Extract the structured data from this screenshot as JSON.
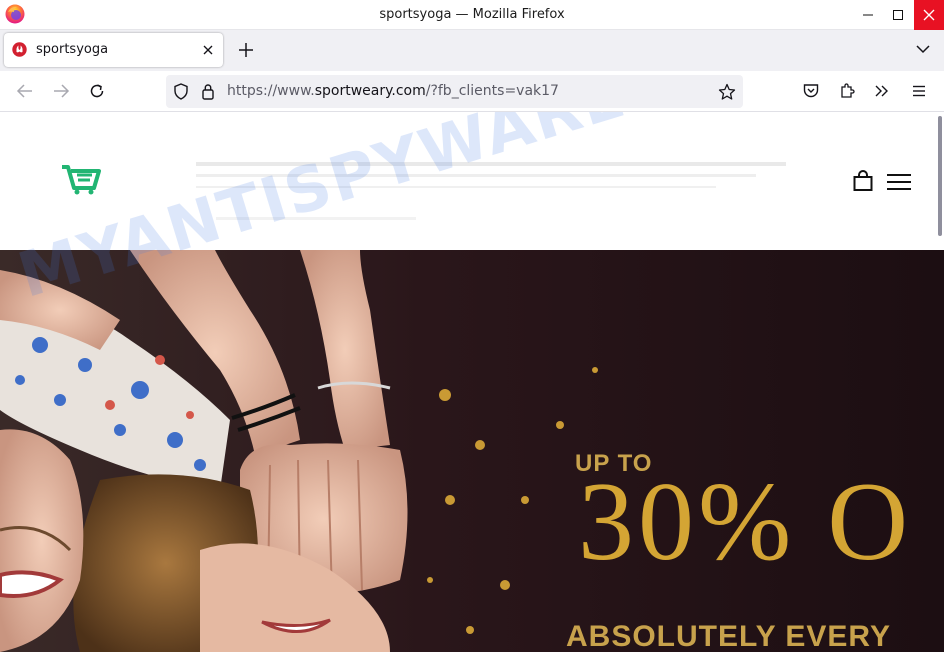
{
  "window": {
    "title": "sportsyoga — Mozilla Firefox",
    "controls": [
      "minimize",
      "maximize",
      "close"
    ]
  },
  "tabs": [
    {
      "label": "sportsyoga",
      "active": true,
      "favicon": "lululemon-icon"
    }
  ],
  "navbar": {
    "url_prefix": "https://www.",
    "url_host": "sportweary.com",
    "url_rest": "/?fb_clients=vak17",
    "icons": [
      "back-icon",
      "forward-icon",
      "reload-icon",
      "shield-icon",
      "lock-icon",
      "bookmark-star-icon",
      "pocket-icon",
      "extensions-icon",
      "overflow-icon",
      "app-menu-icon"
    ]
  },
  "site": {
    "logo_icon": "shopping-cart-logo",
    "logo_color": "#22b573"
  },
  "hero": {
    "promo_top": "UP TO",
    "promo_big": "30% O",
    "promo_bottom": "ABSOLUTELY EVERY",
    "promo_color": "#d4a534"
  },
  "watermark": {
    "text": "MYANTISPYWARE.COM"
  }
}
